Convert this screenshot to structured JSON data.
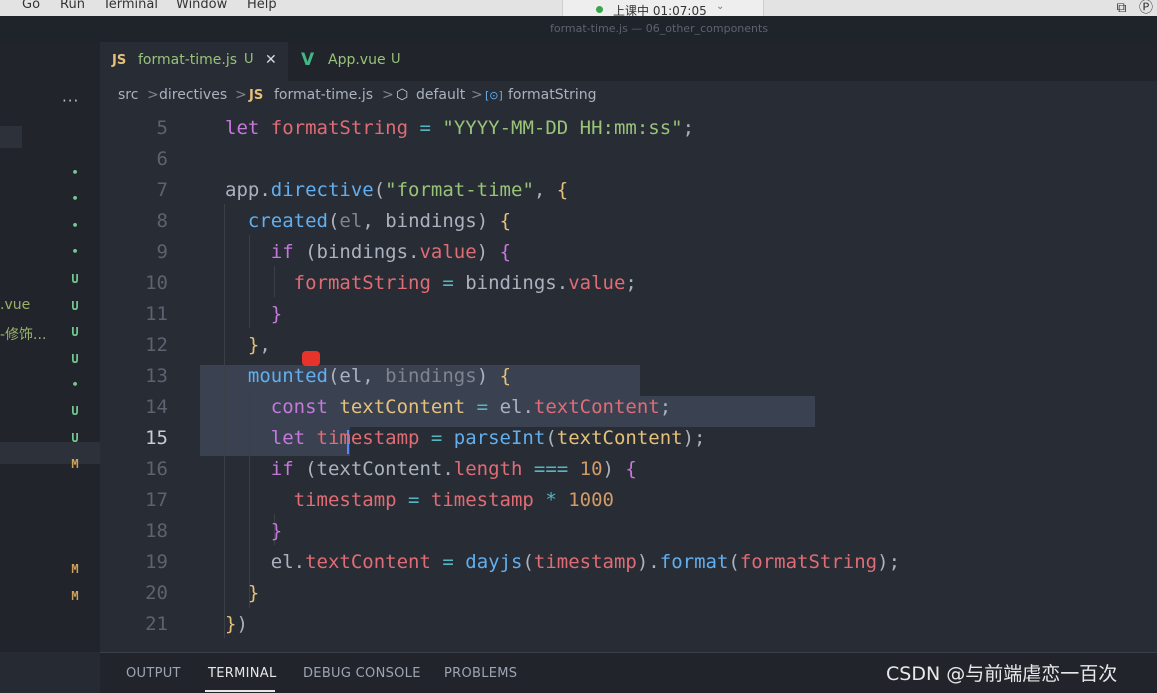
{
  "menubar": {
    "items": [
      "Go",
      "Run",
      "Terminal",
      "Window",
      "Help"
    ],
    "timer_text": "上课中 01:07:05",
    "timer_chevron": "⌄",
    "icons": [
      "screen-share-icon",
      "p-icon"
    ]
  },
  "window_title": "format-time.js — 06_other_components",
  "sidebar": {
    "more_actions": "···",
    "partial_files": [
      ".vue",
      "-修饰..."
    ],
    "badges": [
      "•",
      "•",
      "•",
      "•",
      "U",
      "U",
      "U",
      "U",
      "•",
      "U",
      "U",
      "M",
      "M",
      "M"
    ]
  },
  "tabs": [
    {
      "icon": "JS",
      "label": "format-time.js",
      "status": "U",
      "close": "✕",
      "active": true
    },
    {
      "icon": "V",
      "label": "App.vue",
      "status": "U",
      "active": false
    }
  ],
  "breadcrumbs": {
    "items": [
      "src",
      "directives",
      "format-time.js",
      "default",
      "formatString"
    ],
    "file_icon": "JS",
    "separator": ">",
    "default_icon": "⬡",
    "symbol_icon": "[⊙]"
  },
  "editor": {
    "current_line": 15,
    "line_numbers": [
      "5",
      "6",
      "7",
      "8",
      "9",
      "10",
      "11",
      "12",
      "13",
      "14",
      "15",
      "16",
      "17",
      "18",
      "19",
      "20",
      "21"
    ],
    "code_lines": [
      "let formatString = \"YYYY-MM-DD HH:mm:ss\";",
      "",
      "app.directive(\"format-time\", {",
      "  created(el, bindings) {",
      "    if (bindings.value) {",
      "      formatString = bindings.value;",
      "    }",
      "  },",
      "  mounted(el, bindings) {",
      "    const textContent = el.textContent;",
      "    let timestamp = parseInt(textContent);",
      "    if (textContent.length === 10) {",
      "      timestamp = timestamp * 1000",
      "    }",
      "    el.textContent = dayjs(timestamp).format(formatString);",
      "  }",
      "})"
    ]
  },
  "panel": {
    "tabs": [
      "OUTPUT",
      "TERMINAL",
      "DEBUG CONSOLE",
      "PROBLEMS"
    ],
    "active": "TERMINAL"
  },
  "watermark": "CSDN @与前端虐恋一百次",
  "colors": {
    "keyword": "#c678dd",
    "variable": "#e06c75",
    "string": "#98c379",
    "function": "#61afef",
    "number": "#d19a66",
    "untracked": "#73c991",
    "modified": "#d0a15a"
  }
}
